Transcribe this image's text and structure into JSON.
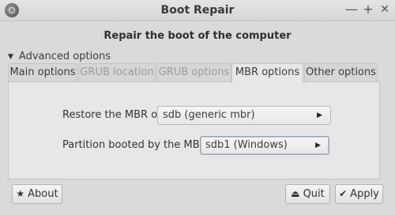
{
  "window": {
    "title": "Boot Repair",
    "controls": {
      "minimize": "—",
      "maximize": "+",
      "close": "✕"
    }
  },
  "heading": "Repair the boot of the computer",
  "expander": {
    "label": "Advanced options",
    "expanded": true
  },
  "tabs": [
    {
      "label": "Main options",
      "state": "normal"
    },
    {
      "label": "GRUB location",
      "state": "disabled"
    },
    {
      "label": "GRUB options",
      "state": "disabled"
    },
    {
      "label": "MBR options",
      "state": "active"
    },
    {
      "label": "Other options",
      "state": "normal"
    }
  ],
  "mbr": {
    "restore_label": "Restore the MBR of:",
    "restore_value": "sdb (generic mbr)",
    "partition_label": "Partition booted by the MBR:",
    "partition_value": "sdb1 (Windows)"
  },
  "buttons": {
    "about": "About",
    "quit": "Quit",
    "apply": "Apply"
  },
  "icons": {
    "app": "boot-repair-icon",
    "about": "star-icon",
    "quit": "exit-icon",
    "apply": "checkmark-icon",
    "dropdown": "triangle-right-icon"
  },
  "colors": {
    "background": "#dadada",
    "panel": "#e7e7e7",
    "border": "#c4c4c4"
  }
}
